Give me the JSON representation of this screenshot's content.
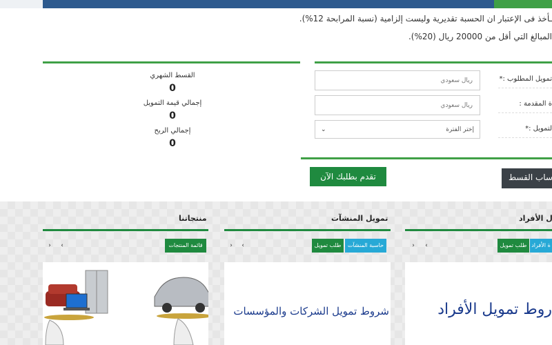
{
  "notes": {
    "line1": "ـأخذ فى الإعتبار ان الحسبة تقديرية وليست إلزامية (نسبة المرابحة 12%).",
    "line2": "المبالغ التي أقل من 20000 ريال (20%)."
  },
  "form": {
    "amount_label": "تمويل المطلوب :*",
    "amount_placeholder": "ريال سعودي",
    "down_label": "ة المقدمة :",
    "down_placeholder": "ريال سعودي",
    "period_label": "لتمويل :*",
    "period_value": "إختر الفترة"
  },
  "results": {
    "monthly_label": "القسط الشهري",
    "monthly_value": "0",
    "total_label": "إجمالي قيمة التمويل",
    "total_value": "0",
    "profit_label": "إجمالي الربح",
    "profit_value": "0"
  },
  "buttons": {
    "calc": "ساب القسط",
    "apply": "تقدم بطلبك الآن"
  },
  "sections": {
    "products": {
      "title": "منتجاتنا",
      "tag1": "قائمة المنتجات"
    },
    "business": {
      "title": "تمويل المنشآت",
      "tag_calc": "حاسبة المنشآت",
      "tag_apply": "طلب تمويل",
      "card_text": "شروط تمويل الشركات والمؤسسات"
    },
    "individuals": {
      "title": "ل الأفراد",
      "tag_calc": "ة الأفراد",
      "tag_apply": "طلب تمويل",
      "card_text": "روط تمويل الأفراد"
    }
  },
  "icons": {
    "prev": "‹",
    "next": "›",
    "chevron": "⌄"
  },
  "colors": {
    "brand_green": "#1f8a3f",
    "accent_green": "#3fa046",
    "brand_blue": "#27a9d6",
    "banner_blue": "#2d5a8e"
  }
}
